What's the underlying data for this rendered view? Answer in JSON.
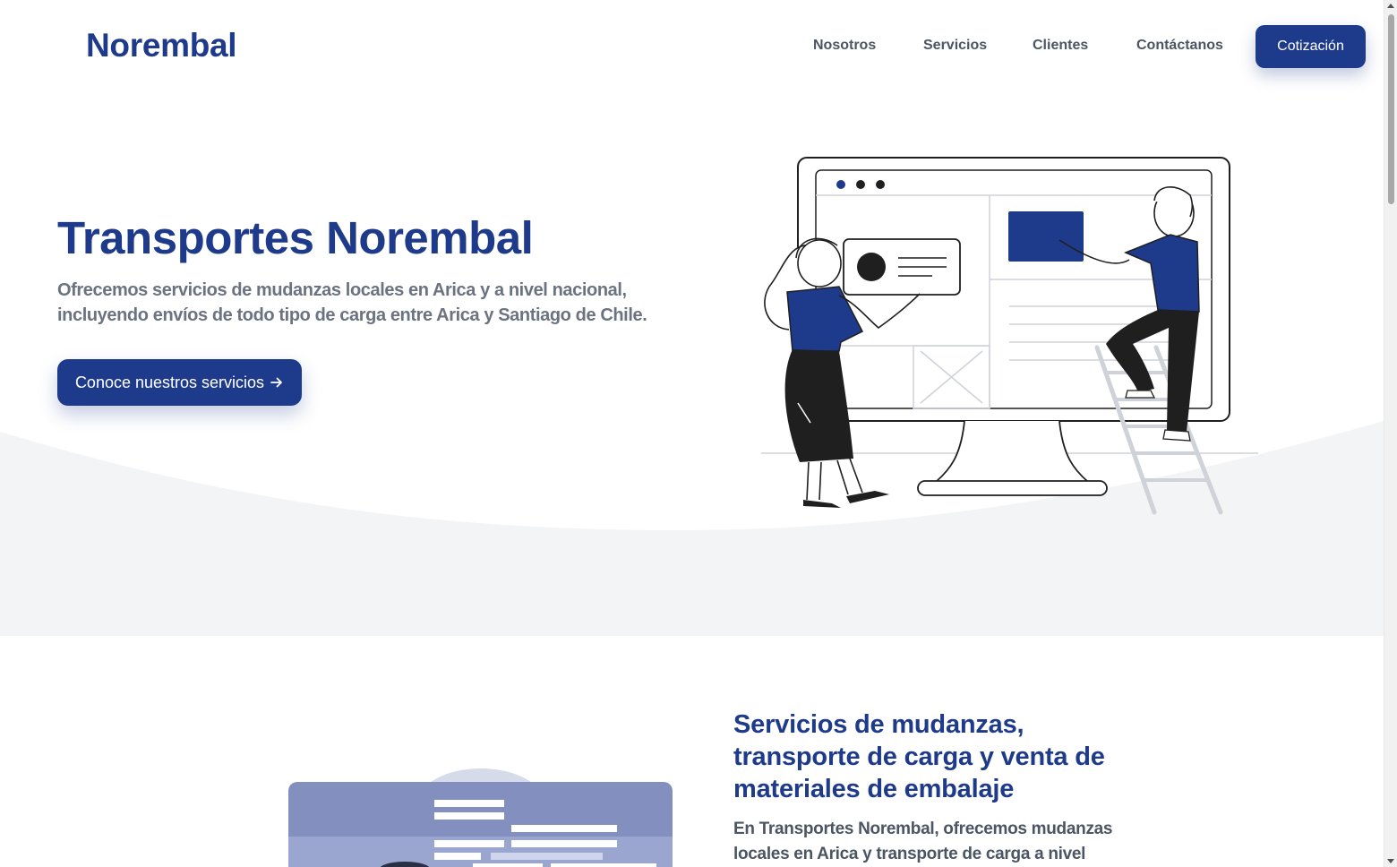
{
  "header": {
    "logo": "Norembal",
    "nav": [
      {
        "label": "Nosotros"
      },
      {
        "label": "Servicios"
      },
      {
        "label": "Clientes"
      },
      {
        "label": "Contáctanos"
      }
    ],
    "quote_button": "Cotización"
  },
  "hero": {
    "title": "Transportes Norembal",
    "subtitle": "Ofrecemos servicios de mudanzas locales en Arica y a nivel nacional, incluyendo envíos de todo tipo de carga entre Arica y Santiago de Chile.",
    "cta_label": "Conoce nuestros servicios",
    "cta_icon": "arrow-right-icon"
  },
  "services_section": {
    "title": "Servicios de mudanzas, transporte de carga y venta de materiales de embalaje",
    "text": "En Transportes Norembal, ofrecemos mudanzas locales en Arica y transporte de carga a nivel"
  },
  "colors": {
    "brand": "#1e3a8a",
    "text_muted": "#6b7280",
    "hero_wave": "#f3f4f6"
  }
}
